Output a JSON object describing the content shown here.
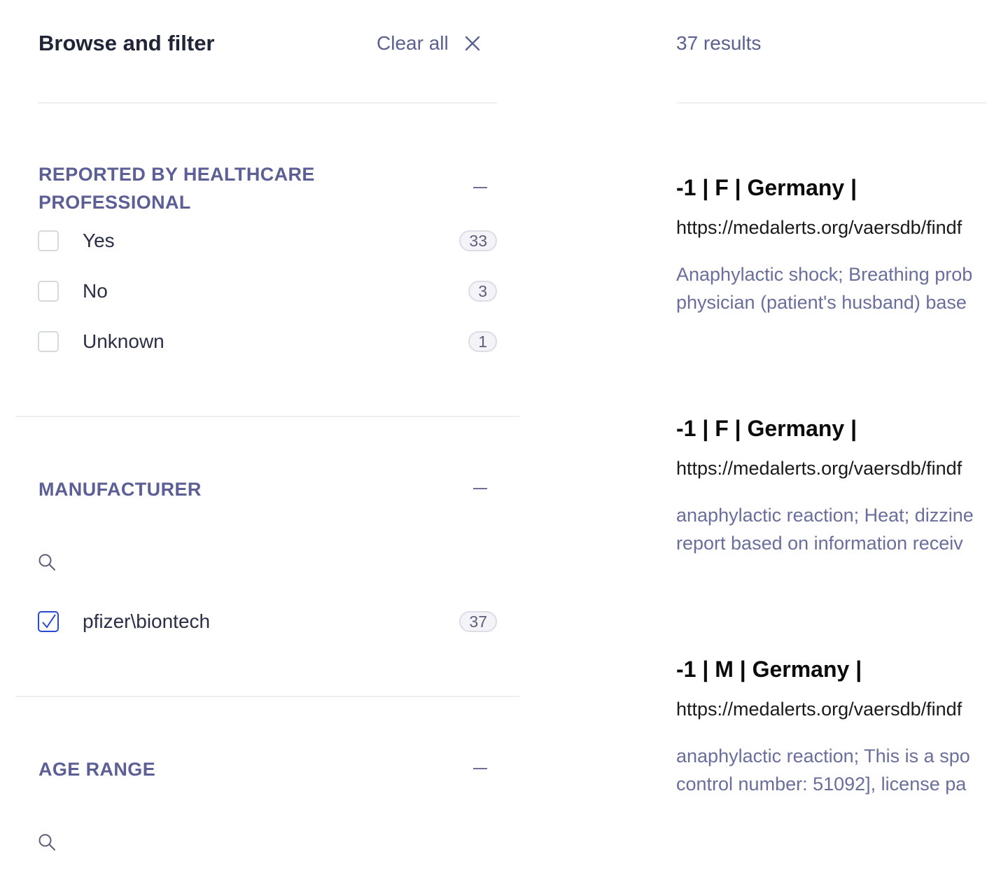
{
  "sidebar": {
    "title": "Browse and filter",
    "clear_all": "Clear all",
    "groups": [
      {
        "title_lines": [
          "REPORTED BY HEALTHCARE",
          "PROFESSIONAL"
        ],
        "options": [
          {
            "label": "Yes",
            "count": "33",
            "checked": false
          },
          {
            "label": "No",
            "count": "3",
            "checked": false
          },
          {
            "label": "Unknown",
            "count": "1",
            "checked": false
          }
        ]
      },
      {
        "title": "MANUFACTURER",
        "options": [
          {
            "label": "pfizer\\biontech",
            "count": "37",
            "checked": true
          }
        ]
      },
      {
        "title": "AGE RANGE"
      }
    ]
  },
  "results": {
    "count_text": "37 results",
    "items": [
      {
        "title": "-1 | F | Germany |",
        "url": "https://medalerts.org/vaersdb/findf",
        "snippet": [
          "Anaphylactic shock; Breathing prob",
          "physician (patient's husband) base"
        ]
      },
      {
        "title": "-1 | F | Germany |",
        "url": "https://medalerts.org/vaersdb/findf",
        "snippet": [
          "anaphylactic reaction; Heat; dizzine",
          "report based on information receiv"
        ]
      },
      {
        "title": "-1 | M | Germany |",
        "url": "https://medalerts.org/vaersdb/findf",
        "snippet": [
          "anaphylactic reaction; This is a spo",
          "control number: 51092], license pa"
        ]
      }
    ]
  },
  "colors": {
    "accent": "#2a4bd1",
    "group_title": "#5b5f96",
    "muted": "#5b6090",
    "snippet": "#6a6e9c"
  },
  "icons": [
    "close-icon",
    "minus-icon",
    "search-icon",
    "check-icon"
  ]
}
